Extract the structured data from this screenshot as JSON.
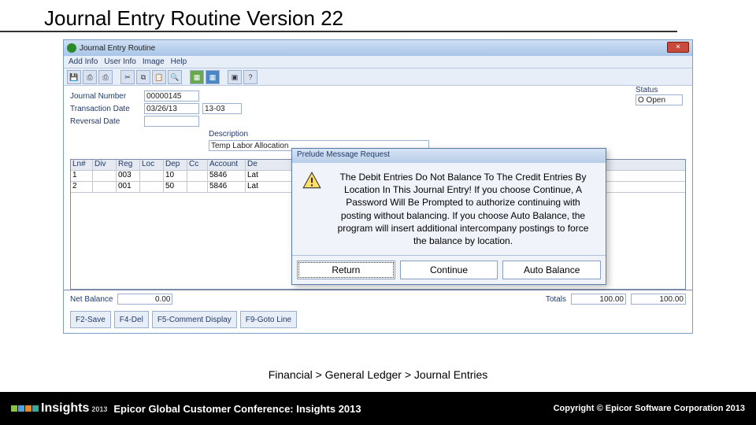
{
  "slide_title": "Journal Entry Routine Version 22",
  "window": {
    "title": "Journal Entry Routine",
    "menus": [
      "Add Info",
      "User Info",
      "Image",
      "Help"
    ],
    "labels": {
      "journal_number": "Journal Number",
      "transaction_date": "Transaction Date",
      "reversal_date": "Reversal Date",
      "description": "Description",
      "status": "Status",
      "net_balance": "Net Balance",
      "totals": "Totals"
    },
    "values": {
      "journal_number": "00000145",
      "transaction_date": "03/26/13",
      "txn_extra": "13-03",
      "reversal_date": "",
      "description": "Temp Labor Allocation",
      "status": "O Open",
      "net_balance": "0.00",
      "total_debit": "100.00",
      "total_credit": "100.00"
    },
    "grid": {
      "headers": [
        "Ln#",
        "Div",
        "Reg",
        "Loc",
        "Dep",
        "Cc",
        "Account",
        "De"
      ],
      "rows": [
        {
          "ln": "1",
          "div": "",
          "reg": "003",
          "loc": "",
          "dep": "10",
          "cc": "",
          "acct": "5846",
          "de": "Lat"
        },
        {
          "ln": "2",
          "div": "",
          "reg": "001",
          "loc": "",
          "dep": "50",
          "cc": "",
          "acct": "5846",
          "de": "Lat"
        }
      ]
    },
    "fn_keys": [
      "F2-Save",
      "F4-Del",
      "F5-Comment Display",
      "F9-Goto Line"
    ]
  },
  "dialog": {
    "title": "Prelude Message Request",
    "message": "The Debit Entries Do Not Balance To The Credit Entries By Location In This Journal Entry! If you choose Continue, A Password Will Be Prompted to authorize continuing with posting without balancing. If you choose Auto Balance, the program will insert additional intercompany postings to force the balance by location.",
    "buttons": [
      "Return",
      "Continue",
      "Auto Balance"
    ]
  },
  "breadcrumb": "Financial > General Ledger > Journal Entries",
  "footer": {
    "logo_text": "Insights",
    "logo_year": "2013",
    "center": "Epicor Global Customer Conference: Insights 2013",
    "right": "Copyright © Epicor Software Corporation 2013"
  }
}
